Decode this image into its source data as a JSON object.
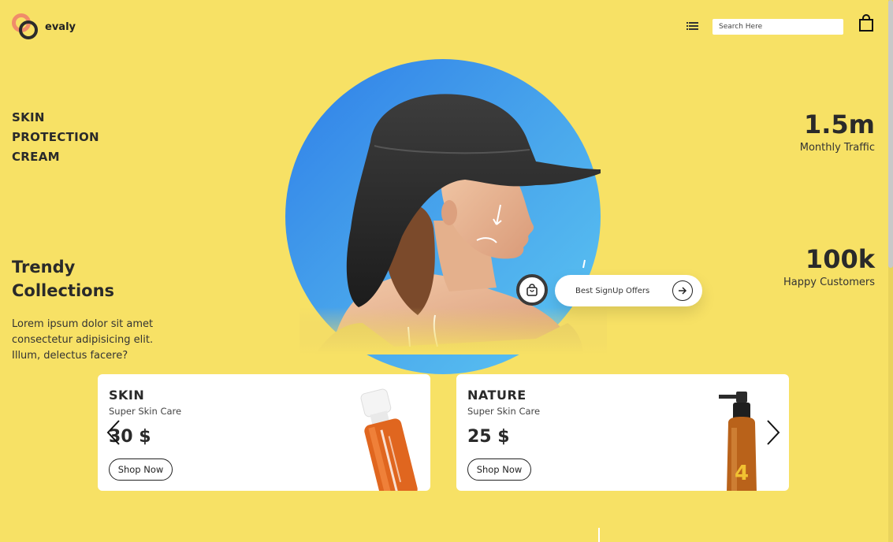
{
  "brand": {
    "name": "evaly"
  },
  "header": {
    "search_placeholder": "Search Here",
    "menu_icon": "list-icon",
    "cart_icon": "shopping-bag-icon"
  },
  "hero": {
    "headline_lines": [
      "SKIN",
      "PROTECTION",
      "CREAM"
    ],
    "section_title_lines": [
      "Trendy",
      "Collections"
    ],
    "description": "Lorem ipsum dolor sit amet consectetur adipisicing elit. Illum, delectus facere?",
    "offer_label": "Best SignUp Offers"
  },
  "stats": [
    {
      "value": "1.5m",
      "label": "Monthly Traffic"
    },
    {
      "value": "100k",
      "label": "Happy Customers"
    }
  ],
  "products": [
    {
      "name": "SKIN",
      "subtitle": "Super Skin Care",
      "price": "30 $",
      "button": "Shop Now"
    },
    {
      "name": "NATURE",
      "subtitle": "Super Skin Care",
      "price": "25 $",
      "button": "Shop Now"
    }
  ],
  "colors": {
    "background": "#f7e165",
    "circle_start": "#2f7fe8",
    "circle_end": "#5cc6f2",
    "logo_accent": "#f08c6a",
    "text_dark": "#2a2a2a"
  }
}
